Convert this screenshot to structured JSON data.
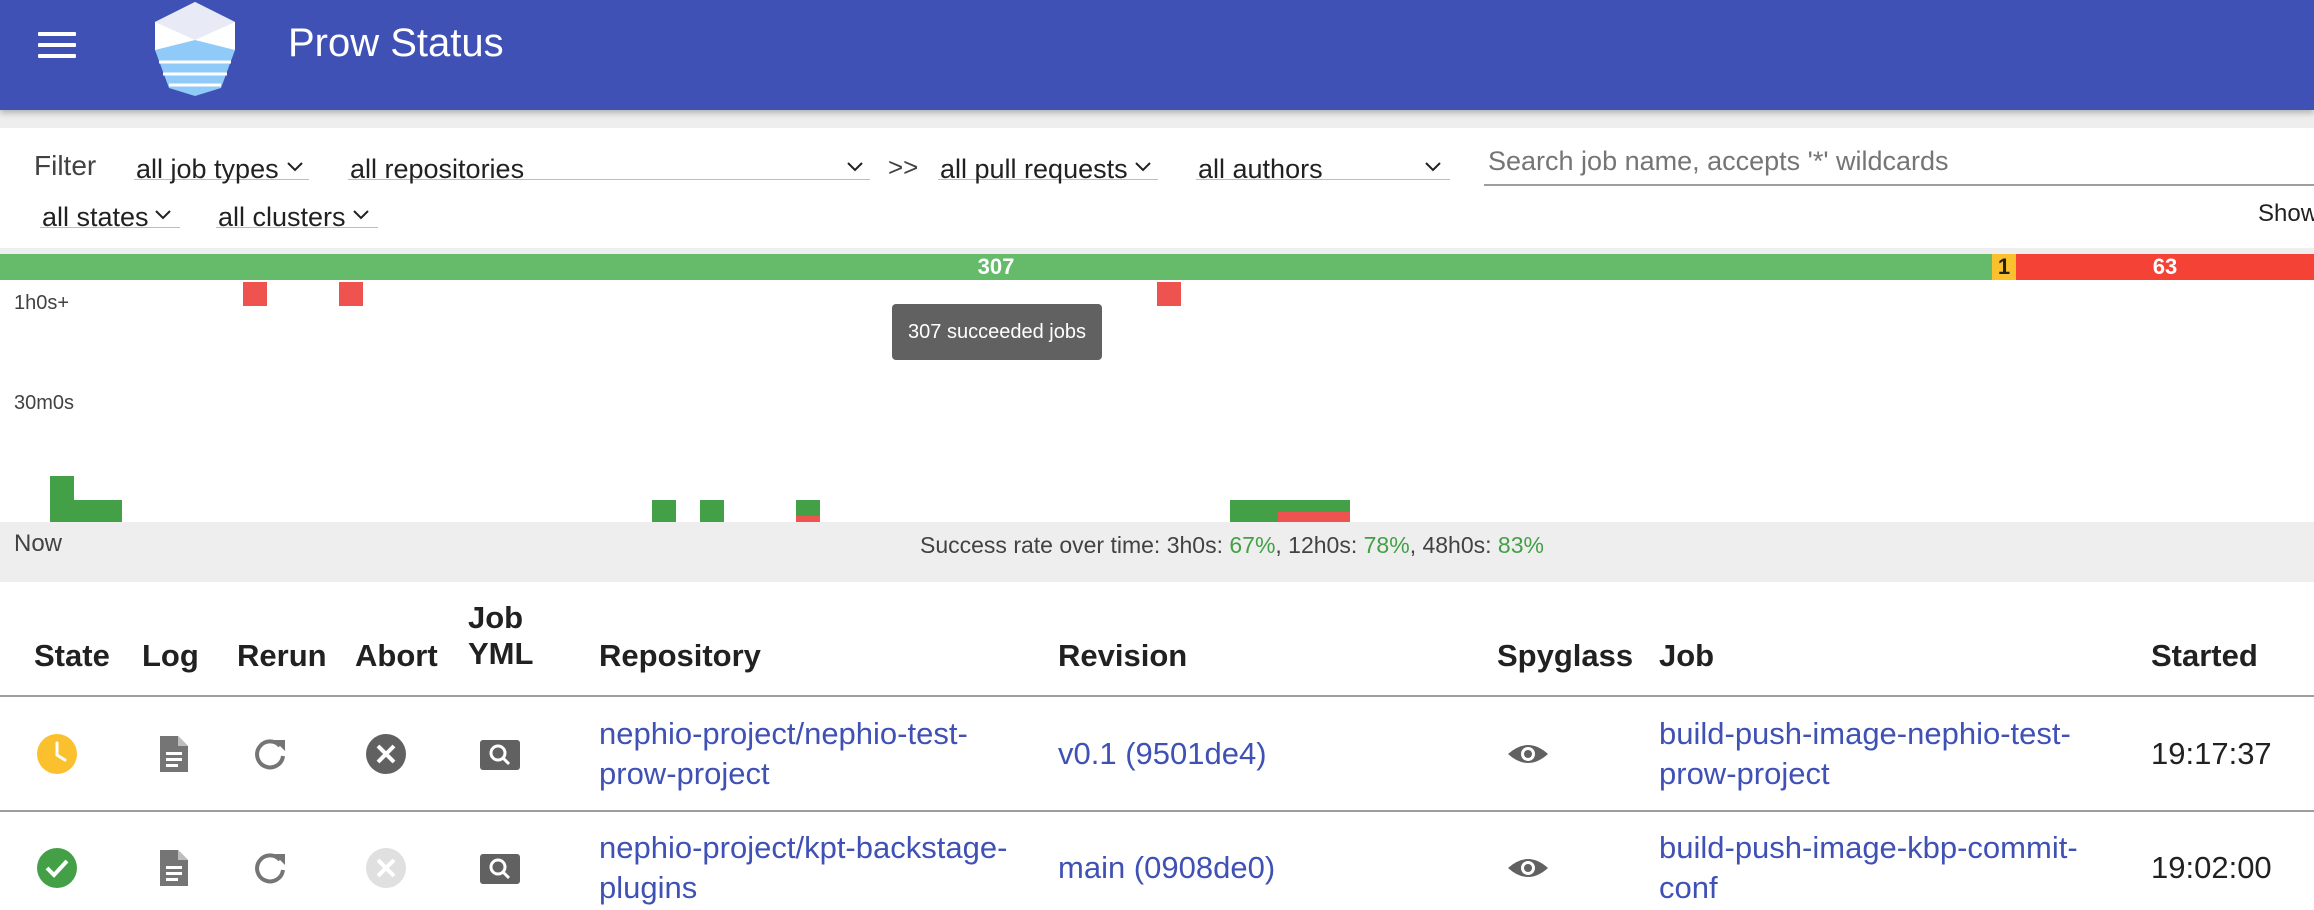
{
  "header": {
    "title": "Prow Status"
  },
  "filters": {
    "label": "Filter",
    "job_types": "all job types",
    "repositories": "all repositories",
    "separator": ">>",
    "pull_requests": "all pull requests",
    "authors": "all authors",
    "search_placeholder": "Search job name, accepts '*' wildcards",
    "states": "all states",
    "clusters": "all clusters",
    "show_label": "Show"
  },
  "summary": {
    "succeeded": "307",
    "pending": "1",
    "failed": "63"
  },
  "histogram": {
    "y_top_label": "1h0s+",
    "y_mid_label": "30m0s",
    "tooltip": "307 succeeded jobs",
    "now_label": "Now",
    "success_rate": {
      "prefix": "Success rate over time: 3h0s: ",
      "p3h": "67%",
      "sep1": ", 12h0s: ",
      "p12h": "78%",
      "sep2": ", 48h0s: ",
      "p48h": "83%"
    }
  },
  "table": {
    "columns": [
      "State",
      "Log",
      "Rerun",
      "Abort",
      "Job\nYML",
      "Repository",
      "Revision",
      "Spyglass",
      "Job",
      "Started"
    ],
    "rows": [
      {
        "state": "pending",
        "repository": "nephio-project/nephio-test-\nprow-project",
        "revision": "v0.1 (9501de4)",
        "job": "build-push-image-nephio-test-\nprow-project",
        "started": "19:17:37",
        "abort_enabled": true
      },
      {
        "state": "success",
        "repository": "nephio-project/kpt-backstage-\nplugins",
        "revision": "main (0908de0)",
        "job": "build-push-image-kbp-commit-\nconf",
        "started": "19:02:00",
        "abort_enabled": false
      }
    ]
  },
  "colors": {
    "primary": "#3f51b5",
    "success": "#43a047",
    "pending": "#fbc02d",
    "failure": "#f44336"
  }
}
